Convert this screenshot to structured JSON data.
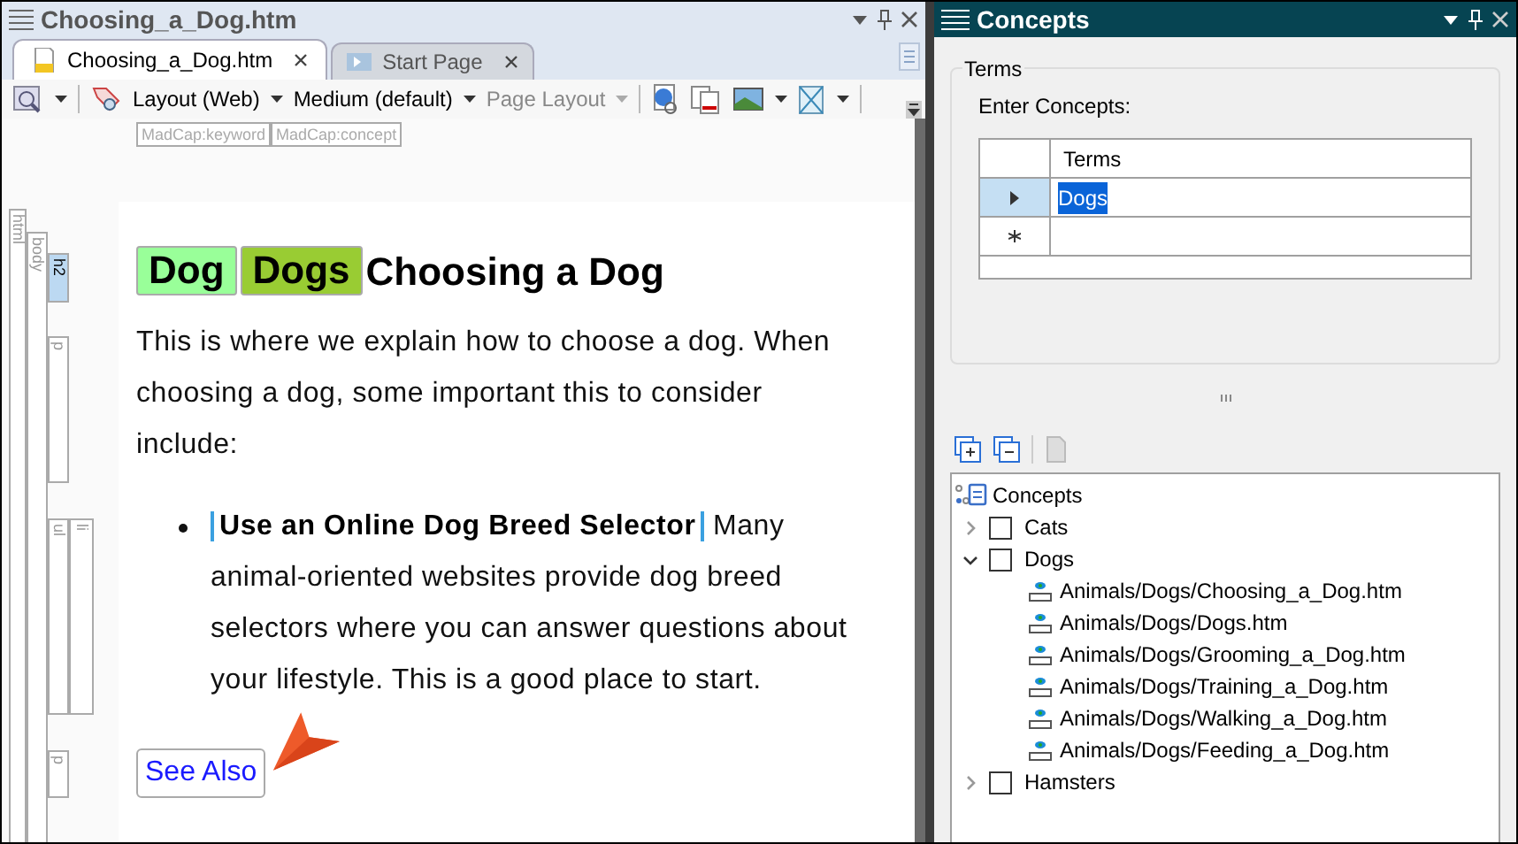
{
  "editor": {
    "title": "Choosing_a_Dog.htm",
    "tabs": [
      {
        "label": "Choosing_a_Dog.htm",
        "selected": true
      },
      {
        "label": "Start Page",
        "selected": false
      }
    ],
    "dropdowns": [
      {
        "label": "Layout (Web)",
        "disabled": false
      },
      {
        "label": "Medium (default)",
        "disabled": false
      },
      {
        "label": "Page Layout",
        "disabled": true
      }
    ],
    "tag_labels": [
      "MadCap:keyword",
      "MadCap:concept"
    ],
    "structure_bars": [
      {
        "label": "html",
        "selected": false
      },
      {
        "label": "body",
        "selected": false
      },
      {
        "label": "h2",
        "selected": true
      },
      {
        "label": "p",
        "selected": false
      },
      {
        "label": "ul",
        "selected": false
      },
      {
        "label": "li",
        "selected": false
      },
      {
        "label": "p",
        "selected": false
      }
    ],
    "document": {
      "keywords": [
        {
          "label": "Dog",
          "color": "#99ff99"
        },
        {
          "label": "Dogs",
          "color": "#99cc33"
        }
      ],
      "heading": "Choosing a Dog",
      "paragraph": "This is where we explain how to choose a dog. When choosing a dog, some important this to consider include:",
      "bullets": [
        {
          "link": "Use an Online Dog Breed Selector",
          "text": "Many animal-oriented websites provide dog breed selectors where you can answer questions about your lifestyle. This is a good place to start."
        }
      ],
      "see_also": "See Also"
    }
  },
  "concepts": {
    "title": "Concepts",
    "group_label": "Terms",
    "prompt": "Enter Concepts:",
    "grid": {
      "column": "Terms",
      "rows": [
        {
          "value": "Dogs",
          "selected": true
        }
      ]
    },
    "tree": {
      "root": "Concepts",
      "children": [
        {
          "label": "Cats",
          "expanded": false,
          "checked": false
        },
        {
          "label": "Dogs",
          "expanded": true,
          "checked": false,
          "children": [
            {
              "label": "Animals/Dogs/Choosing_a_Dog.htm"
            },
            {
              "label": "Animals/Dogs/Dogs.htm"
            },
            {
              "label": "Animals/Dogs/Grooming_a_Dog.htm"
            },
            {
              "label": "Animals/Dogs/Training_a_Dog.htm"
            },
            {
              "label": "Animals/Dogs/Walking_a_Dog.htm"
            },
            {
              "label": "Animals/Dogs/Feeding_a_Dog.htm"
            }
          ]
        },
        {
          "label": "Hamsters",
          "expanded": false,
          "checked": false
        }
      ]
    }
  }
}
